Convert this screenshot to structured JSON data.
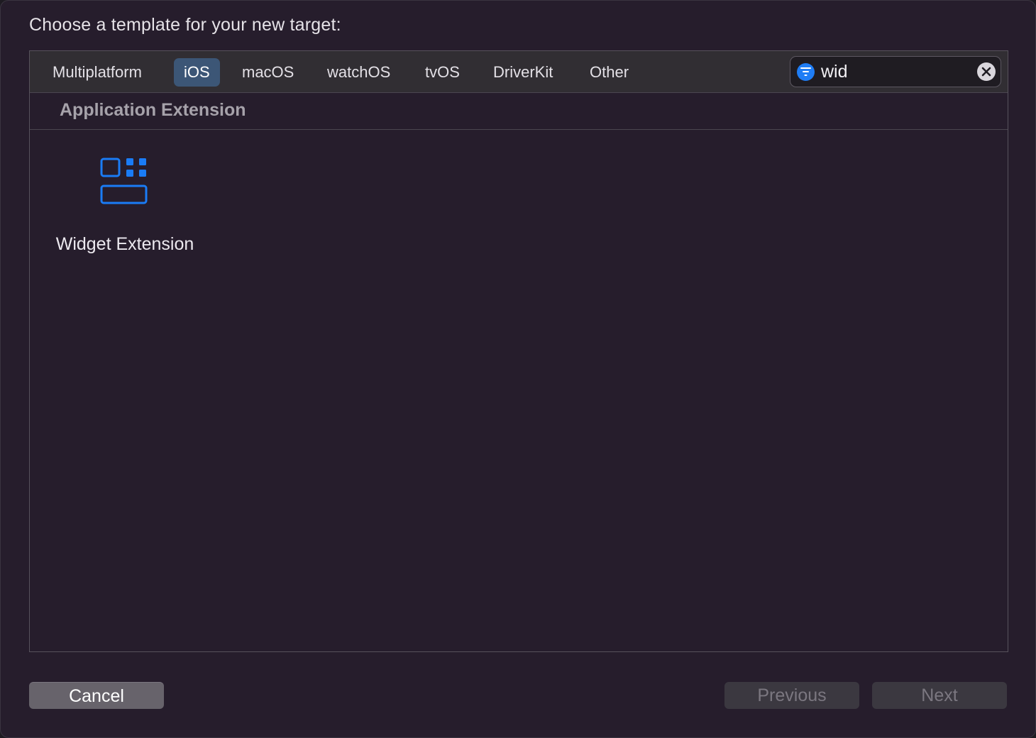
{
  "prompt": "Choose a template for your new target:",
  "tabs": [
    {
      "label": "Multiplatform",
      "selected": false
    },
    {
      "label": "iOS",
      "selected": true
    },
    {
      "label": "macOS",
      "selected": false
    },
    {
      "label": "watchOS",
      "selected": false
    },
    {
      "label": "tvOS",
      "selected": false
    },
    {
      "label": "DriverKit",
      "selected": false
    },
    {
      "label": "Other",
      "selected": false
    }
  ],
  "search": {
    "value": "wid",
    "filter_icon": "filter-icon",
    "clear_icon": "clear-icon"
  },
  "section": {
    "title": "Application Extension"
  },
  "templates": [
    {
      "label": "Widget Extension",
      "icon": "widget-icon"
    }
  ],
  "buttons": {
    "cancel": "Cancel",
    "previous": "Previous",
    "next": "Next"
  },
  "colors": {
    "accent": "#1f7df5",
    "selected_tab": "#3c5676",
    "background": "#261d2c"
  }
}
